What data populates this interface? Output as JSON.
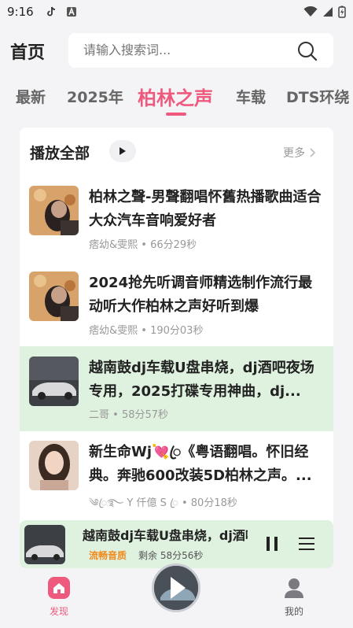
{
  "status_bar": {
    "time": "9:16"
  },
  "header": {
    "title": "首页",
    "search_placeholder": "请输入搜索词..."
  },
  "tabs": [
    {
      "label": "最新"
    },
    {
      "label": "2025年"
    },
    {
      "label": "柏林之声",
      "active": true
    },
    {
      "label": "车载"
    },
    {
      "label": "DTS环绕"
    }
  ],
  "section": {
    "play_all": "播放全部",
    "more": "更多"
  },
  "songs": [
    {
      "title": "柏林之聲-男聲翻唱怀舊热播歌曲适合大众汽车音响爱好者",
      "artist": "痞幼&雯熙",
      "duration": "66分29秒"
    },
    {
      "title": "2024抢先听调音师精选制作流行最动听大作柏林之声好听到爆",
      "artist": "痞幼&雯熙",
      "duration": "190分03秒"
    },
    {
      "title": "越南鼓dj车载U盘串烧，dj酒吧夜场专用，2025打碟专用神曲，dj...",
      "artist": "二哥",
      "duration": "58分57秒"
    },
    {
      "title": "新生命Wj💘ꦿ《粤语翻唱。怀旧经典。奔驰600改装5D柏林之声。...",
      "artist": "༄ꦿ࿐ Y 仟億 S ꦿ",
      "duration": "80分18秒"
    }
  ],
  "meta_separator": "•",
  "mini_player": {
    "title": "越南鼓dj车载U盘串烧，dj酒吧夜场专用",
    "quality": "流畅音质",
    "remaining": "剩余 58分56秒"
  },
  "bottom_nav": {
    "discover": "发现",
    "mine": "我的"
  },
  "colors": {
    "accent": "#ee5a7e",
    "highlight_bg": "#dff1df",
    "quality": "#f08a1c"
  }
}
